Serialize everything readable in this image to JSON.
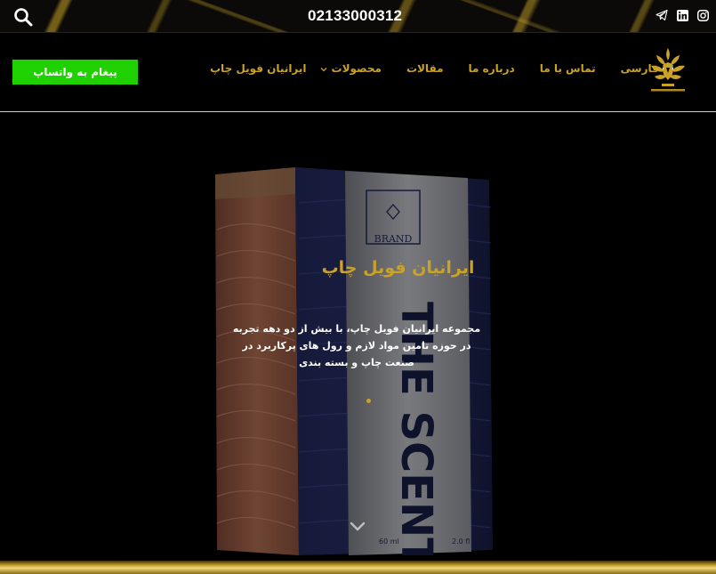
{
  "topbar": {
    "phone": "02133000312",
    "search_icon": "search-icon",
    "socials": [
      "instagram-icon",
      "linkedin-icon",
      "telegram-icon"
    ]
  },
  "nav": {
    "brand": "ایرانیان فویل چاپ",
    "items": [
      {
        "label": "محصولات",
        "has_dropdown": true
      },
      {
        "label": "مقالات"
      },
      {
        "label": "درباره ما"
      },
      {
        "label": "تماس با ما"
      },
      {
        "label": "فارسی",
        "flag": "iran-flag-icon"
      }
    ],
    "whatsapp_label": "پیغام به واتساپ",
    "logo_icon": "company-logo-icon"
  },
  "hero": {
    "title": "ایرانیان فویل چاپ",
    "description": "مجموعه ایرانیان فویل چاپ، با بیش از دو دهه تجربه در حوزه تامین مواد لازم و رول های پرکاربرد در صنعت چاپ و بسته بندی",
    "box_brand": "BRAND",
    "box_text": "THE SCENT",
    "box_size_left": "60 ml",
    "box_size_right": "2.0 fl"
  },
  "colors": {
    "gold": "#c9a227",
    "whatsapp_green": "#1fd100",
    "background": "#000000"
  }
}
